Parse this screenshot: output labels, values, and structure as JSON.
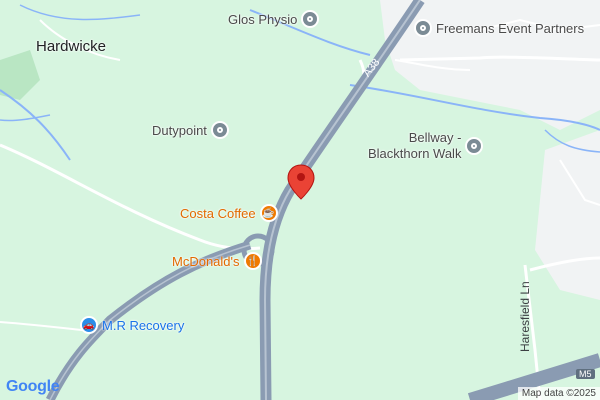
{
  "map": {
    "place_label": "Hardwicke",
    "pois": [
      {
        "name": "Glos Physio",
        "style": "grey",
        "icon": "place-icon"
      },
      {
        "name": "Freemans Event Partners",
        "style": "grey",
        "icon": "place-icon"
      },
      {
        "name": "Dutypoint",
        "style": "grey",
        "icon": "place-icon"
      },
      {
        "name": "Bellway -",
        "name2": "Blackthorn Walk",
        "style": "grey",
        "icon": "place-icon"
      },
      {
        "name": "Costa Coffee",
        "style": "orange",
        "icon": "coffee-cup-icon"
      },
      {
        "name": "McDonald's",
        "style": "orange",
        "icon": "fork-knife-icon"
      },
      {
        "name": "M.R Recovery",
        "style": "blue",
        "icon": "car-repair-icon"
      }
    ],
    "road_labels": {
      "a38": "A38",
      "m5_shield": "M5",
      "lane": "Haresfield Ln"
    },
    "logo": "Google",
    "attribution": "Map data ©2025",
    "colors": {
      "land": "#d7f5e0",
      "water": "#8ab4f8",
      "motorway": "#8a9bb2",
      "urban": "#f1f3f4",
      "marker": "#ea4335"
    }
  }
}
